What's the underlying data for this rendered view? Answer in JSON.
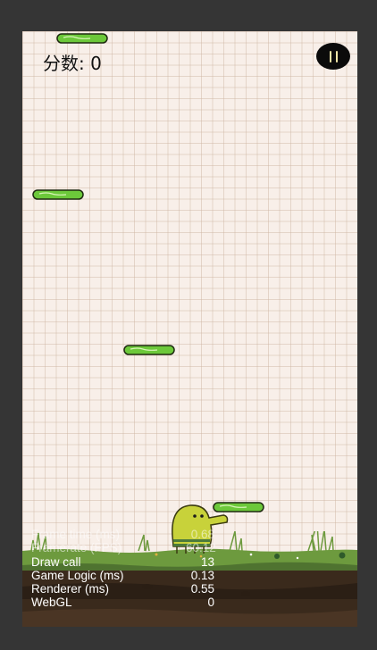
{
  "hud": {
    "score_label": "分数: 0",
    "pause_icon": "pause-icon"
  },
  "stats": [
    {
      "label": "Frame time (ms)",
      "value": "0.68"
    },
    {
      "label": "Framerate (FPS)",
      "value": "60.12"
    },
    {
      "label": "Draw call",
      "value": "13"
    },
    {
      "label": "Game Logic (ms)",
      "value": "0.13"
    },
    {
      "label": "Renderer (ms)",
      "value": "0.55"
    },
    {
      "label": "WebGL",
      "value": "0"
    }
  ],
  "colors": {
    "platform_green": "#6cc83a",
    "doodler_yellow": "#c8d23a",
    "grass_green": "#6d9a3e",
    "soil_dark": "#3a2a1c"
  }
}
